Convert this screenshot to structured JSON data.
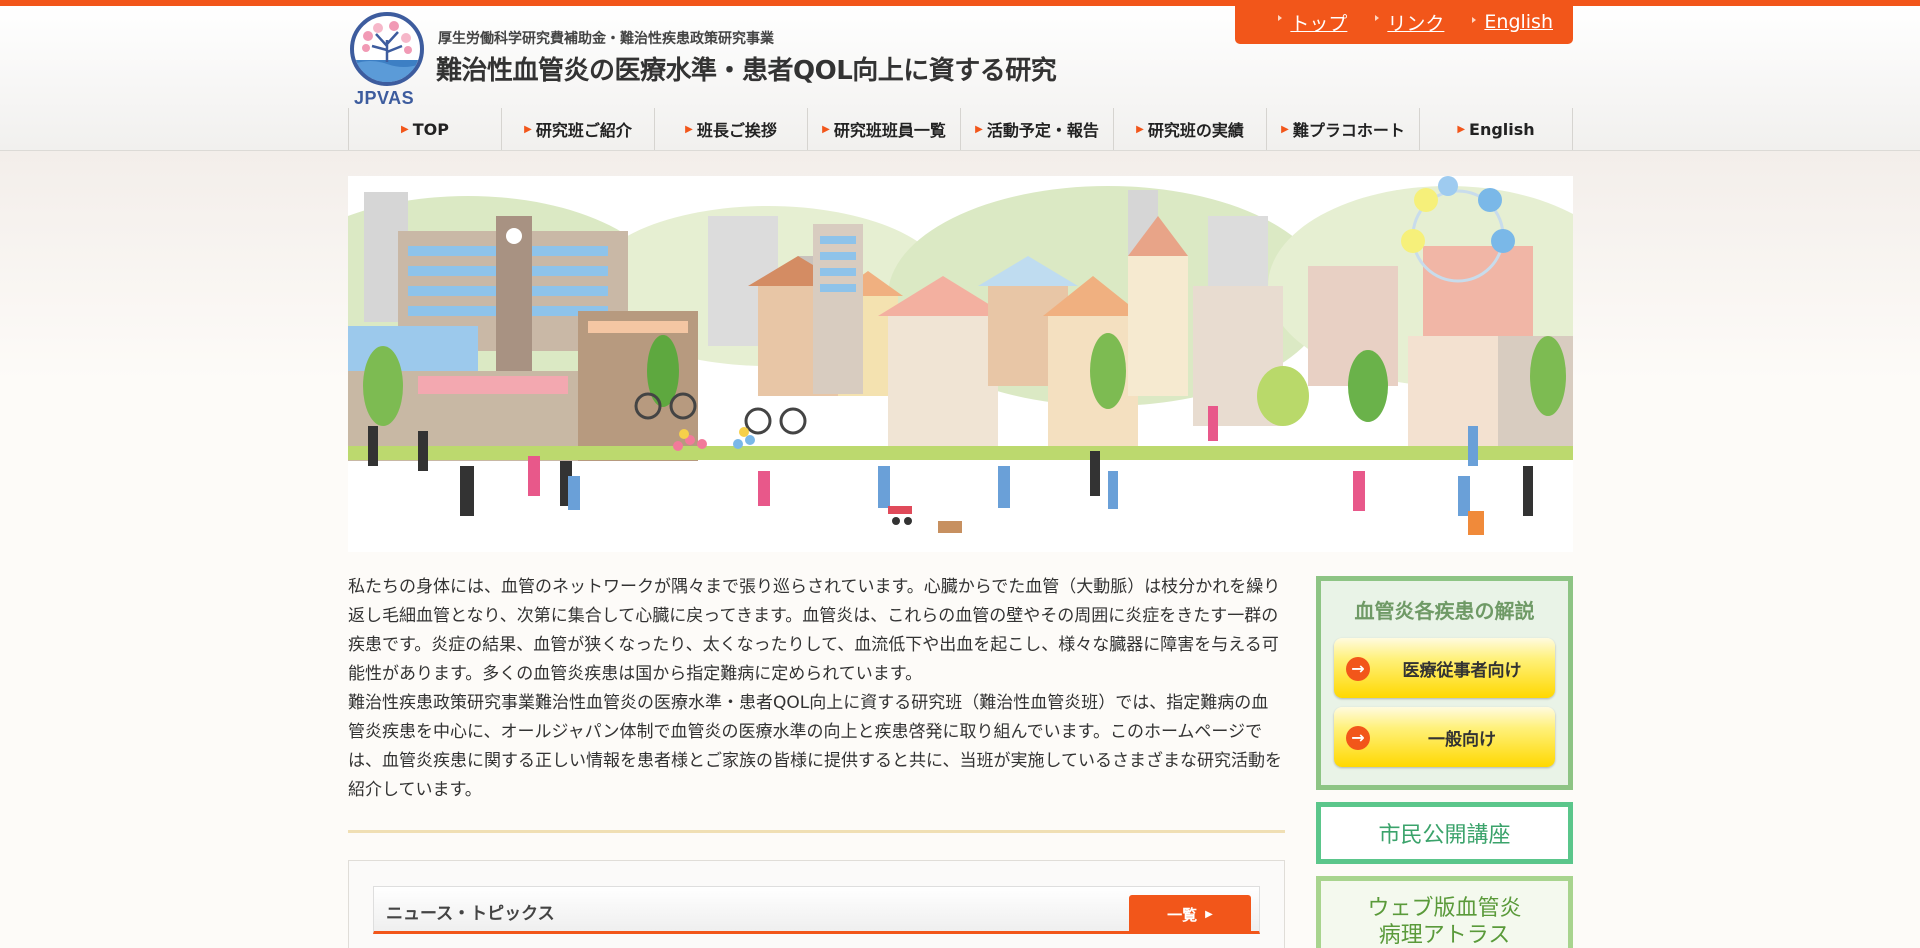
{
  "header": {
    "logo_text": "JPVAS",
    "subtitle": "厚生労働科学研究費補助金・難治性疾患政策研究事業",
    "title": "難治性血管炎の医療水準・患者QOL向上に資する研究"
  },
  "top_links": [
    "トップ",
    "リンク",
    "English"
  ],
  "nav": [
    "TOP",
    "研究班ご紹介",
    "班長ご挨拶",
    "研究班班員一覧",
    "活動予定・報告",
    "研究班の実績",
    "難プラコホート",
    "English"
  ],
  "intro": {
    "p1": "私たちの身体には、血管のネットワークが隅々まで張り巡らされています。心臓からでた血管（大動脈）は枝分かれを繰り返し毛細血管となり、次第に集合して心臓に戻ってきます。血管炎は、これらの血管の壁やその周囲に炎症をきたす一群の疾患です。炎症の結果、血管が狭くなったり、太くなったりして、血流低下や出血を起こし、様々な臓器に障害を与える可能性があります。多くの血管炎疾患は国から指定難病に定められています。",
    "p2": "難治性疾患政策研究事業難治性血管炎の医療水準・患者QOL向上に資する研究班（難治性血管炎班）では、指定難病の血管炎疾患を中心に、オールジャパン体制で血管炎の医療水準の向上と疾患啓発に取り組んでいます。このホームページでは、血管炎疾患に関する正しい情報を患者様とご家族の皆様に提供すると共に、当班が実施しているさまざまな研究活動を紹介しています。"
  },
  "news": {
    "title": "ニュース・トピックス",
    "all_button": "一覧"
  },
  "sidebar": {
    "disease_title": "血管炎各疾患の解説",
    "btn_medical": "医療従事者向け",
    "btn_general": "一般向け",
    "lecture": "市民公開講座",
    "atlas_line1": "ウェブ版血管炎",
    "atlas_line2": "病理アトラス"
  },
  "colors": {
    "accent": "#f2561a",
    "green_border": "#8dc484",
    "teal_border": "#5bc68b",
    "button_yellow": "#ffd800"
  }
}
